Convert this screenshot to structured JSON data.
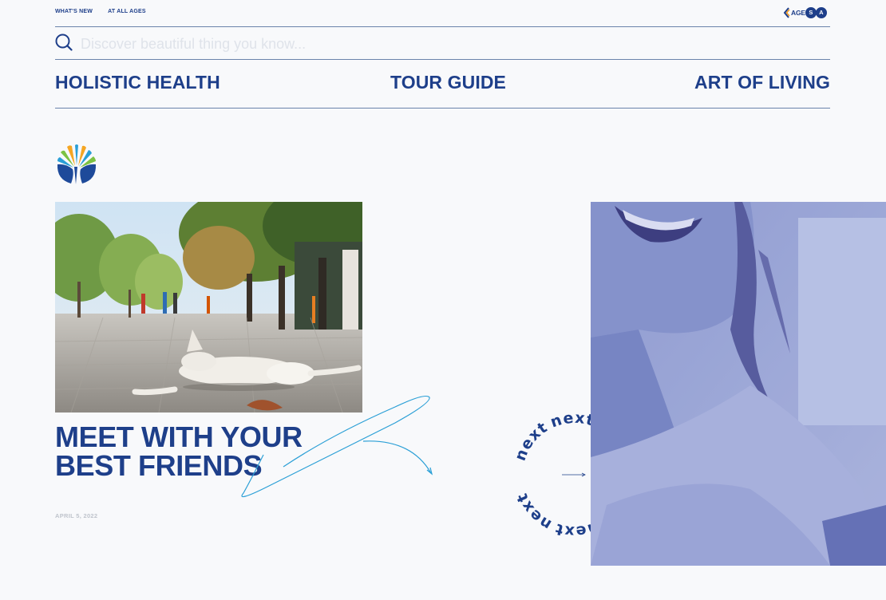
{
  "topnav": {
    "whats_new": "WHAT'S NEW",
    "at_all_ages": "AT ALL AGES"
  },
  "brand": {
    "name": "AGE",
    "s": "S",
    "a": "A",
    "icon": "chevron-logo-icon"
  },
  "search": {
    "placeholder": "Discover beautiful thing you know...",
    "value": ""
  },
  "categories": [
    "HOLISTIC HEALTH",
    "TOUR GUIDE",
    "ART OF LIVING"
  ],
  "article": {
    "title_line1": "MEET WITH YOUR",
    "title_line2": "BEST FRIENDS",
    "date": "APRIL 5, 2022",
    "image": "white dog sleeping on paved street"
  },
  "next_widget": {
    "label": "next",
    "arrow": "right-arrow-icon"
  },
  "colors": {
    "primary": "#1e3f8a",
    "accent": "#2a9fd6",
    "background": "#f8f9fb",
    "muted": "#bfc4cc"
  }
}
